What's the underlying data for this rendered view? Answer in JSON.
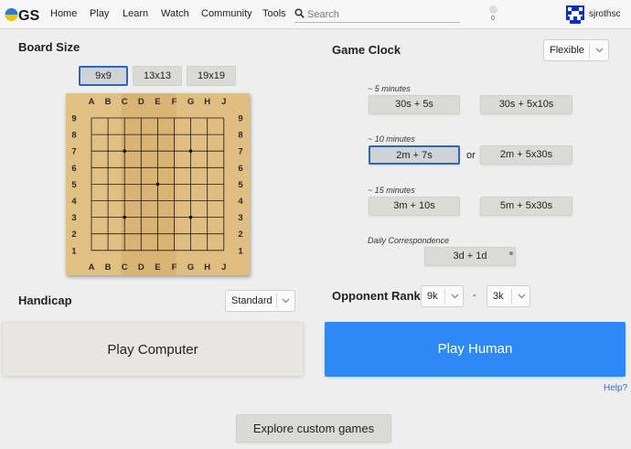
{
  "nav": {
    "logo_text": "GS",
    "links": [
      "Home",
      "Play",
      "Learn",
      "Watch",
      "Community",
      "Tools"
    ],
    "search_placeholder": "Search",
    "notification_count": "0",
    "username": "sjrothsc"
  },
  "board_size": {
    "title": "Board Size",
    "options": [
      "9x9",
      "13x13",
      "19x19"
    ],
    "selected": "9x9",
    "col_labels": [
      "A",
      "B",
      "C",
      "D",
      "E",
      "F",
      "G",
      "H",
      "J"
    ],
    "row_labels": [
      "9",
      "8",
      "7",
      "6",
      "5",
      "4",
      "3",
      "2",
      "1"
    ],
    "star_points": [
      "C7",
      "G7",
      "E5",
      "C3",
      "G3"
    ]
  },
  "handicap": {
    "title": "Handicap",
    "value": "Standard"
  },
  "game_clock": {
    "title": "Game Clock",
    "mode": "Flexible",
    "groups": [
      {
        "label": "~ 5 minutes",
        "options": [
          "30s + 5s",
          "30s + 5x10s"
        ]
      },
      {
        "label": "~ 10 minutes",
        "options": [
          "2m + 7s",
          "2m + 5x30s"
        ],
        "separator": "or"
      },
      {
        "label": "~ 15 minutes",
        "options": [
          "3m + 10s",
          "5m + 5x30s"
        ]
      },
      {
        "label": "Daily Correspondence",
        "options": [
          "3d + 1d"
        ]
      }
    ],
    "selected": "2m + 7s"
  },
  "opponent_rank": {
    "title": "Opponent Rank",
    "min": "9k",
    "separator": "-",
    "max": "3k"
  },
  "actions": {
    "play_computer": "Play Computer",
    "play_human": "Play Human",
    "help": "Help?",
    "explore": "Explore custom games"
  },
  "colors": {
    "accent": "#2f66b8",
    "primary_button": "#2e88f6",
    "board_wood": "#dcb778",
    "link": "#2a6fd6"
  }
}
